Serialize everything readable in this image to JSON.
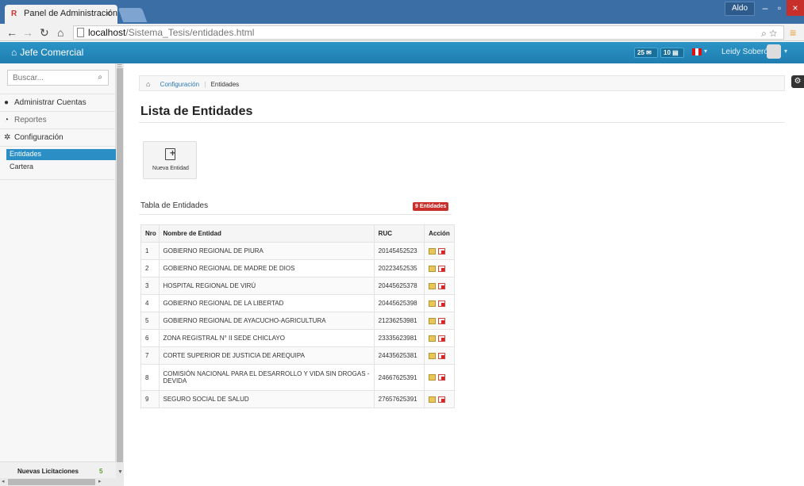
{
  "browser": {
    "tab_title": "Panel de Administración",
    "tab_close": "×",
    "user_button": "Aldo",
    "url_host": "localhost",
    "url_path": "/Sistema_Tesis/entidades.html"
  },
  "header": {
    "brand": "Jefe Comercial",
    "badge_mail": "25",
    "badge_notif": "10",
    "user_name": "Leidy Soberón"
  },
  "sidebar": {
    "search_placeholder": "Buscar...",
    "items": [
      {
        "label": "Administrar Cuentas",
        "icon": "user-icon"
      },
      {
        "label": "Reportes",
        "icon": "chart-icon"
      },
      {
        "label": "Configuración",
        "icon": "gear-icon"
      }
    ],
    "sub_items": [
      {
        "label": "Entidades",
        "active": true
      },
      {
        "label": "Cartera",
        "active": false
      }
    ],
    "footer_label": "Nuevas Licitaciones",
    "footer_count": "5"
  },
  "breadcrumb": {
    "link": "Configuración",
    "current": "Entidades"
  },
  "page": {
    "title": "Lista de Entidades",
    "new_button": "Nueva Entidad",
    "section_title": "Tabla de Entidades",
    "count_badge": "9 Entidades"
  },
  "table": {
    "headers": [
      "Nro",
      "Nombre de Entidad",
      "RUC",
      "Acción"
    ],
    "rows": [
      {
        "nro": "1",
        "name": "GOBIERNO REGIONAL DE PIURA",
        "ruc": "20145452523"
      },
      {
        "nro": "2",
        "name": "GOBIERNO REGIONAL DE MADRE DE DIOS",
        "ruc": "20223452535"
      },
      {
        "nro": "3",
        "name": "HOSPITAL REGIONAL DE VIRÚ",
        "ruc": "20445625378"
      },
      {
        "nro": "4",
        "name": "GOBIERNO REGIONAL DE LA LIBERTAD",
        "ruc": "20445625398"
      },
      {
        "nro": "5",
        "name": "GOBIERNO REGIONAL DE AYACUCHO-AGRICULTURA",
        "ruc": "21236253981"
      },
      {
        "nro": "6",
        "name": "ZONA REGISTRAL N° II SEDE CHICLAYO",
        "ruc": "23335623981"
      },
      {
        "nro": "7",
        "name": "CORTE SUPERIOR DE JUSTICIA DE AREQUIPA",
        "ruc": "24435625381"
      },
      {
        "nro": "8",
        "name": "COMISIÓN NACIONAL PARA EL DESARROLLO Y VIDA SIN DROGAS - DEVIDA",
        "ruc": "24667625391"
      },
      {
        "nro": "9",
        "name": "SEGURO SOCIAL DE SALUD",
        "ruc": "27657625391"
      }
    ]
  },
  "colors": {
    "header_blue": "#2b94c6",
    "active_blue": "#2b8fc6",
    "badge_red": "#c9302c"
  }
}
